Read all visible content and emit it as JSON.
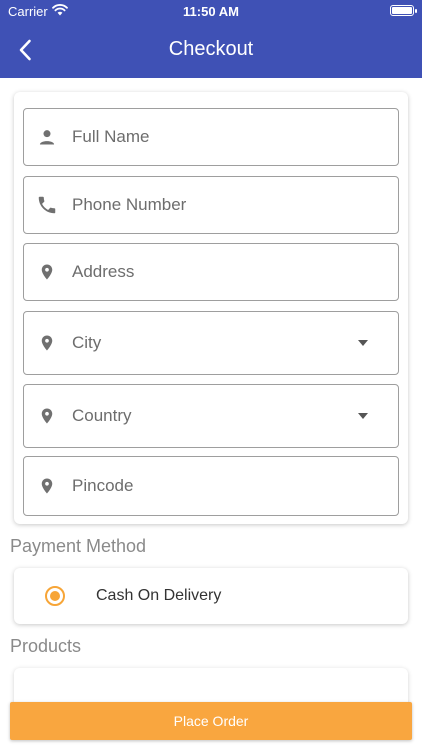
{
  "status_bar": {
    "carrier": "Carrier",
    "time": "11:50 AM"
  },
  "header": {
    "title": "Checkout",
    "background_color": "#3f51b5"
  },
  "form": {
    "fields": [
      {
        "placeholder": "Full Name",
        "icon": "person-icon",
        "type": "text"
      },
      {
        "placeholder": "Phone Number",
        "icon": "phone-icon",
        "type": "text"
      },
      {
        "placeholder": "Address",
        "icon": "location-pin-icon",
        "type": "text"
      },
      {
        "placeholder": "City",
        "icon": "location-pin-icon",
        "type": "dropdown"
      },
      {
        "placeholder": "Country",
        "icon": "location-pin-icon",
        "type": "dropdown"
      },
      {
        "placeholder": "Pincode",
        "icon": "location-pin-icon",
        "type": "text"
      }
    ]
  },
  "payment": {
    "heading": "Payment Method",
    "option_label": "Cash On Delivery",
    "selected": true,
    "accent_color": "#f7a537"
  },
  "products": {
    "heading": "Products"
  },
  "footer": {
    "place_order_label": "Place Order",
    "button_color": "#f9a63f"
  }
}
